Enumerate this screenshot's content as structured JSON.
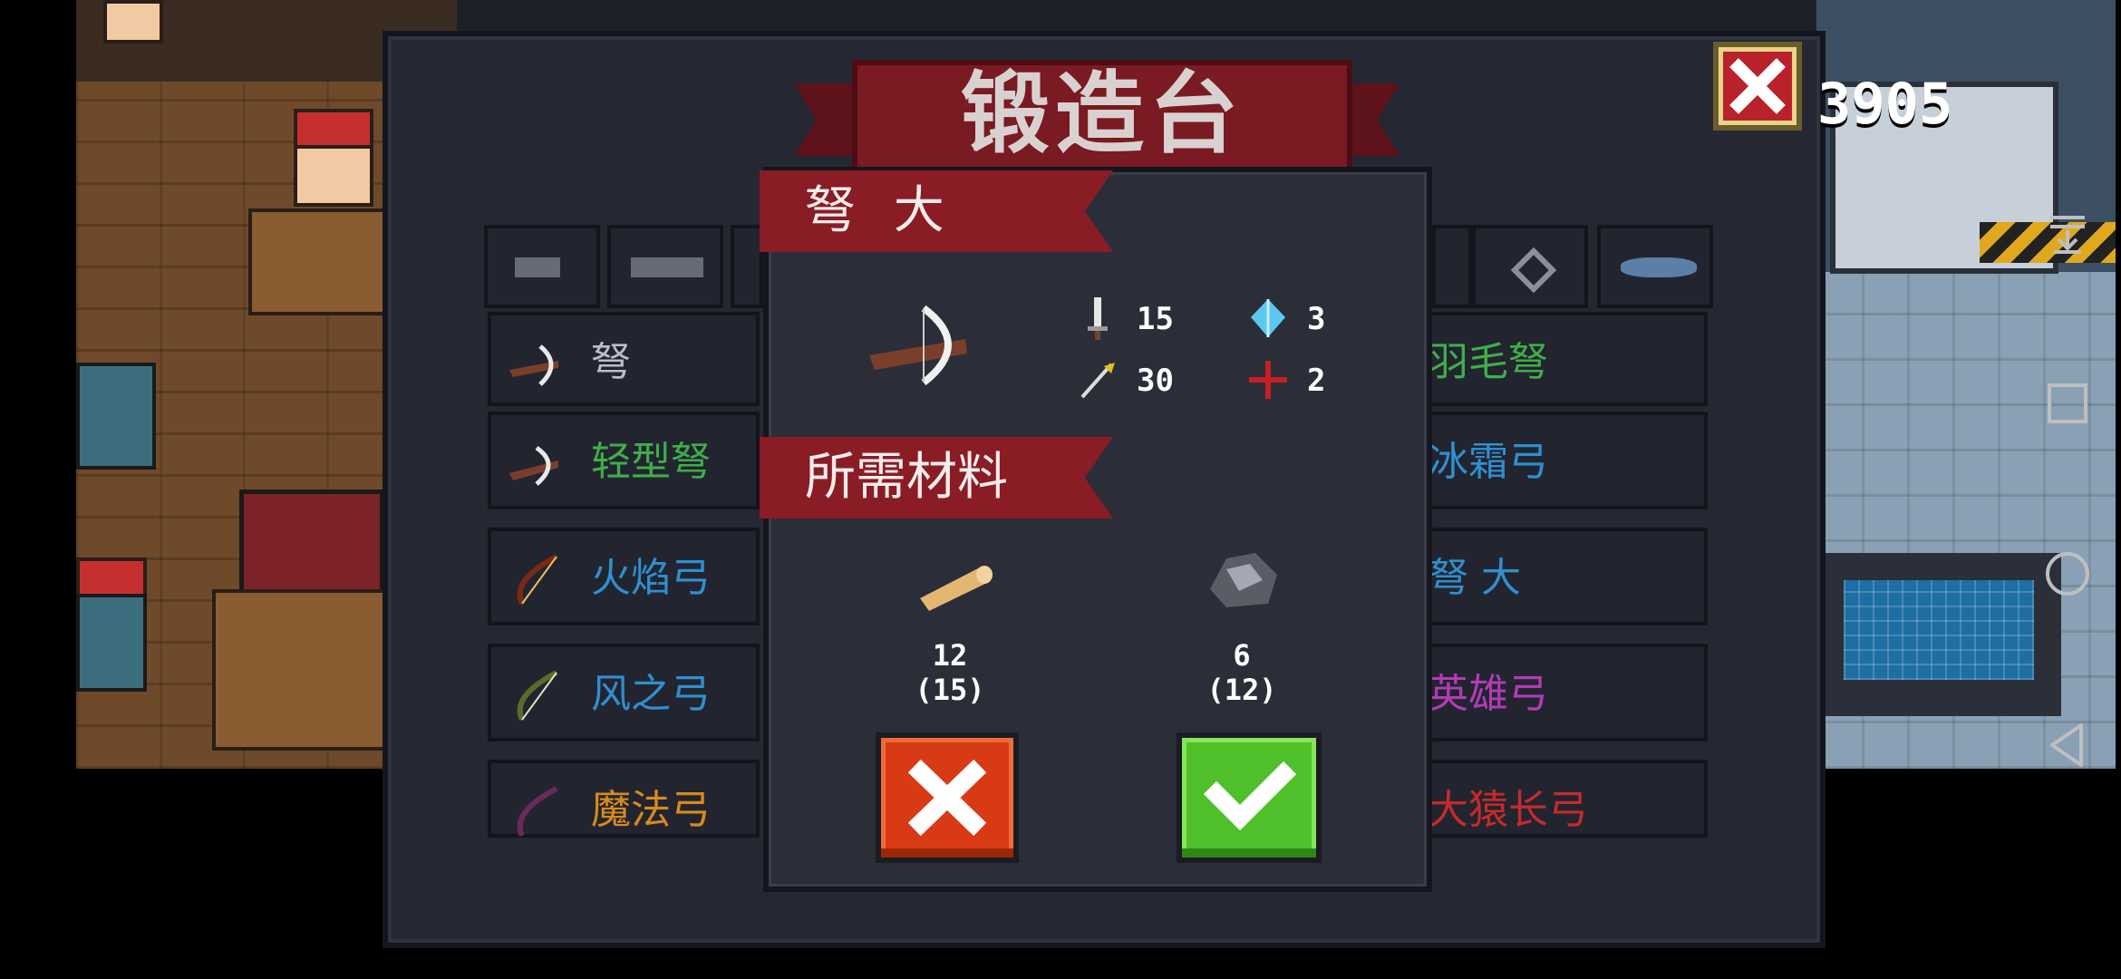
{
  "hud": {
    "coins": "3905"
  },
  "forge": {
    "title": "锻造台"
  },
  "tabs": [
    {
      "icon": "pistol-icon"
    },
    {
      "icon": "rifle-icon"
    },
    {
      "icon": "shotgun-icon"
    },
    {
      "icon": "bow-icon"
    },
    {
      "icon": "melee-icon"
    },
    {
      "icon": "crosshair-icon"
    },
    {
      "icon": "fish-icon"
    }
  ],
  "weapons_left": [
    {
      "name": "弩",
      "color": "#b9bec8"
    },
    {
      "name": "轻型弩",
      "color": "#3fae4a"
    },
    {
      "name": "火焰弓",
      "color": "#2f8fd0"
    },
    {
      "name": "风之弓",
      "color": "#2f8fd0"
    },
    {
      "name": "魔法弓",
      "color": "#d98a1c"
    }
  ],
  "weapons_right": [
    {
      "name": "羽毛弩",
      "color": "#3fae4a"
    },
    {
      "name": "冰霜弓",
      "color": "#2f8fd0"
    },
    {
      "name": "弩 大",
      "color": "#2f8fd0"
    },
    {
      "name": "英雄弓",
      "color": "#b33ab8"
    },
    {
      "name": "大猿长弓",
      "color": "#c52b2b"
    }
  ],
  "modal": {
    "weapon_name": "弩 大",
    "materials_header": "所需材料",
    "stats": {
      "damage": "15",
      "energy": "3",
      "crit": "30",
      "accuracy": "2"
    },
    "materials": [
      {
        "icon": "wood-log-icon",
        "have": "12",
        "need": "(15)"
      },
      {
        "icon": "iron-ore-icon",
        "have": "6",
        "need": "(12)"
      }
    ]
  }
}
